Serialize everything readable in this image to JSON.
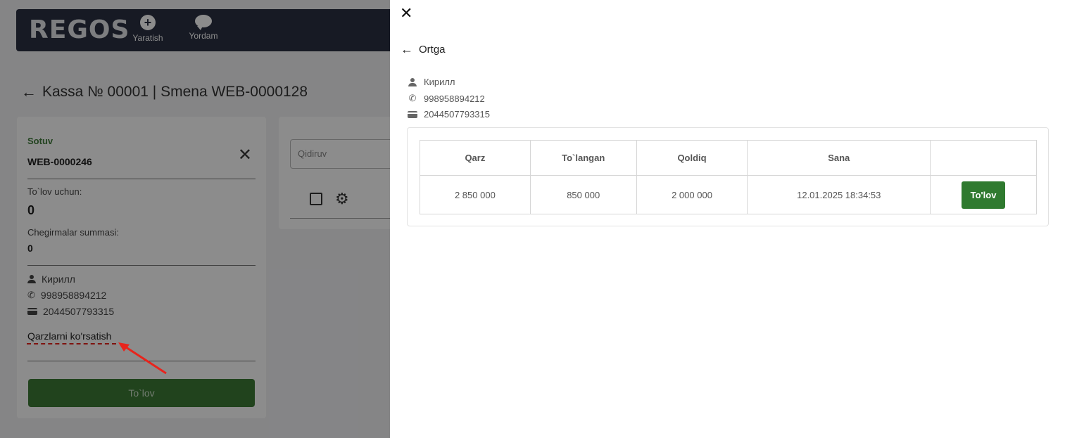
{
  "app": {
    "logo": "REGOS",
    "nav": [
      {
        "label": "Yaratish",
        "icon": "plus-circle-icon"
      },
      {
        "label": "Yordam",
        "icon": "chat-bubble-icon"
      }
    ],
    "page_title": "Kassa № 00001 | Smena WEB-0000128"
  },
  "sale": {
    "type_label": "Sotuv",
    "doc_number": "WEB-0000246",
    "to_pay_label": "To`lov uchun:",
    "to_pay_value": "0",
    "discount_label": "Chegirmalar summasi:",
    "discount_value": "0",
    "customer_name": "Кирилл",
    "phone": "998958894212",
    "card": "2044507793315",
    "show_debts_link": "Qarzlarni ko'rsatish",
    "pay_button": "To`lov"
  },
  "search": {
    "placeholder": "Qidiruv"
  },
  "drawer": {
    "back_label": "Ortga",
    "customer_name": "Кирилл",
    "phone": "998958894212",
    "card": "2044507793315",
    "table": {
      "headers": [
        "Qarz",
        "To`langan",
        "Qoldiq",
        "Sana",
        ""
      ],
      "rows": [
        {
          "qarz": "2 850 000",
          "tolangan": "850 000",
          "qoldiq": "2 000 000",
          "sana": "12.01.2025 18:34:53",
          "action": "To'lov"
        }
      ]
    }
  },
  "colors": {
    "topbar": "#2b3142",
    "accent_green": "#2f7a2f",
    "annotation_red": "#e8241c"
  }
}
